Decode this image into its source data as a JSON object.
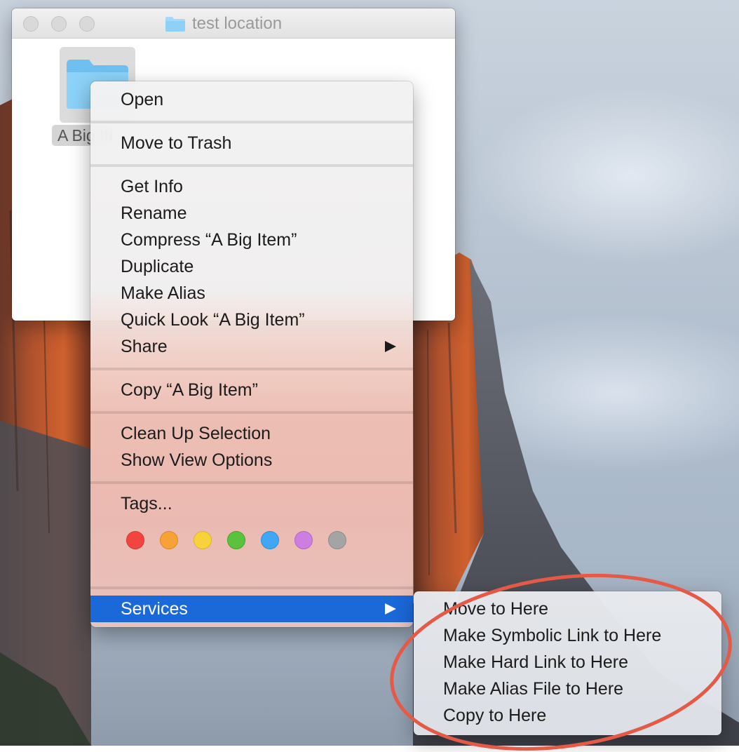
{
  "window": {
    "title": "test location",
    "file_label": "A Big Item"
  },
  "context_menu": {
    "items": [
      {
        "label": "Open"
      },
      {
        "label": "Move to Trash"
      },
      {
        "label": "Get Info"
      },
      {
        "label": "Rename"
      },
      {
        "label": "Compress “A Big Item”"
      },
      {
        "label": "Duplicate"
      },
      {
        "label": "Make Alias"
      },
      {
        "label": "Quick Look “A Big Item”"
      },
      {
        "label": "Share"
      },
      {
        "label": "Copy “A Big Item”"
      },
      {
        "label": "Clean Up Selection"
      },
      {
        "label": "Show View Options"
      },
      {
        "label": "Tags..."
      },
      {
        "label": "Services"
      }
    ],
    "tag_colors": [
      {
        "name": "red",
        "color": "#f2453f"
      },
      {
        "name": "orange",
        "color": "#f7a237"
      },
      {
        "name": "yellow",
        "color": "#f8d23b"
      },
      {
        "name": "green",
        "color": "#5ac23c"
      },
      {
        "name": "blue",
        "color": "#3fa7f5"
      },
      {
        "name": "purple",
        "color": "#cc7fe0"
      },
      {
        "name": "gray",
        "color": "#a4a4a4"
      }
    ]
  },
  "services_submenu": {
    "items": [
      {
        "label": "Move to Here"
      },
      {
        "label": "Make Symbolic Link to Here"
      },
      {
        "label": "Make Hard Link to Here"
      },
      {
        "label": "Make Alias File to Here"
      },
      {
        "label": "Copy to Here"
      }
    ]
  },
  "colors": {
    "highlight": "#1b68d9",
    "annotation": "#e45a47",
    "folder": "#78c7f5"
  }
}
